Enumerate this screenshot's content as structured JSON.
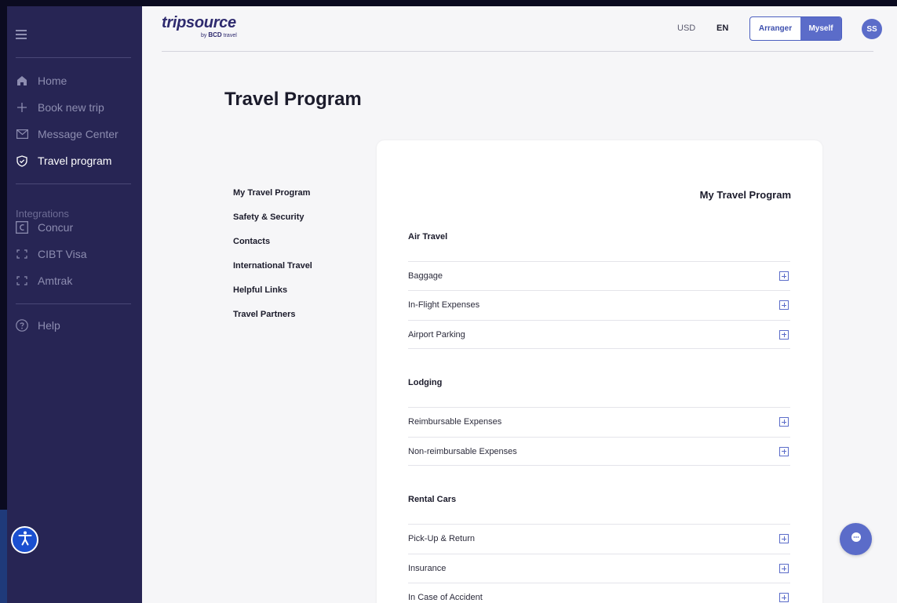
{
  "app": {
    "logo_text_a": "trip",
    "logo_text_b": "source",
    "logo_sub_prefix": "by",
    "logo_sub_brand": "BCD",
    "logo_sub_suffix": "travel"
  },
  "header": {
    "currency": "USD",
    "language": "EN",
    "toggle_arranger": "Arranger",
    "toggle_myself": "Myself",
    "avatar_initials": "SS"
  },
  "sidebar": {
    "items": [
      {
        "label": "Home",
        "icon": "home-icon"
      },
      {
        "label": "Book new trip",
        "icon": "plus-icon"
      },
      {
        "label": "Message Center",
        "icon": "mail-icon"
      },
      {
        "label": "Travel program",
        "icon": "shield-check-icon",
        "active": true
      }
    ],
    "integrations_heading": "Integrations",
    "integrations": [
      {
        "label": "Concur",
        "icon": "concur-icon"
      },
      {
        "label": "CIBT Visa",
        "icon": "bracket-icon"
      },
      {
        "label": "Amtrak",
        "icon": "bracket-icon"
      }
    ],
    "help": {
      "label": "Help",
      "icon": "help-circle-icon"
    }
  },
  "page": {
    "title": "Travel Program",
    "subnav": [
      "My Travel Program",
      "Safety & Security",
      "Contacts",
      "International Travel",
      "Helpful Links",
      "Travel Partners"
    ]
  },
  "card": {
    "title": "My Travel Program",
    "sections": [
      {
        "title": "Air Travel",
        "rows": [
          "Baggage",
          "In-Flight Expenses",
          "Airport Parking"
        ]
      },
      {
        "title": "Lodging",
        "rows": [
          "Reimbursable Expenses",
          "Non-reimbursable Expenses"
        ]
      },
      {
        "title": "Rental Cars",
        "rows": [
          "Pick-Up & Return",
          "Insurance",
          "In Case of Accident"
        ]
      }
    ]
  },
  "colors": {
    "sidebar_bg": "#272554",
    "accent": "#5b6cc9",
    "page_bg": "#f6f6f8"
  }
}
